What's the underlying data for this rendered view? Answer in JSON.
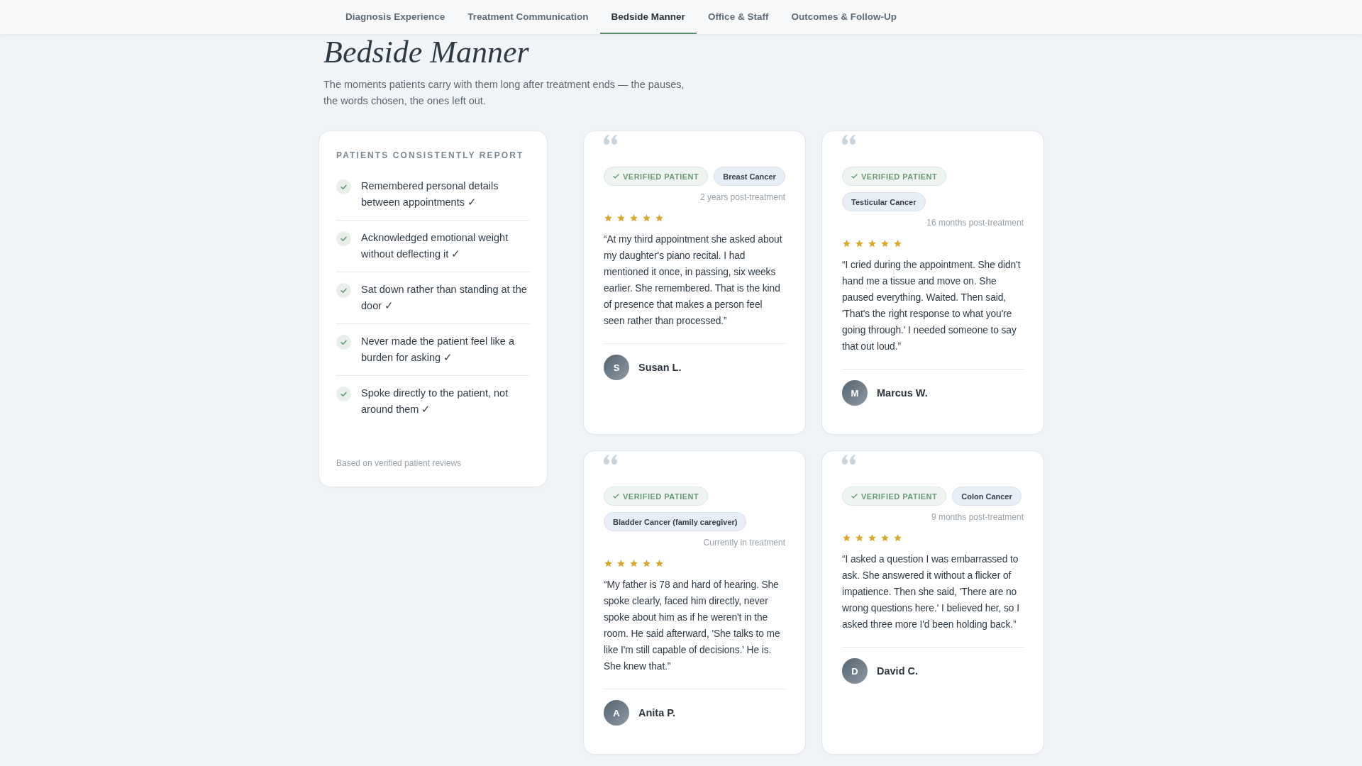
{
  "nav": {
    "tabs": [
      {
        "label": "Diagnosis Experience",
        "selected": false
      },
      {
        "label": "Treatment Communication",
        "selected": false
      },
      {
        "label": "Bedside Manner",
        "selected": true
      },
      {
        "label": "Office & Staff",
        "selected": false
      },
      {
        "label": "Outcomes & Follow-Up",
        "selected": false
      }
    ]
  },
  "header": {
    "title": "Bedside Manner",
    "description": "The moments patients carry with them long after treatment ends — the pauses, the words chosen, the ones left out."
  },
  "summary": {
    "title": "PATIENTS CONSISTENTLY REPORT",
    "items": [
      {
        "text": "Remembered personal details between appointments ✓"
      },
      {
        "text": "Acknowledged emotional weight without deflecting it ✓"
      },
      {
        "text": "Sat down rather than standing at the door ✓"
      },
      {
        "text": "Never made the patient feel like a burden for asking ✓"
      },
      {
        "text": "Spoke directly to the patient, not around them ✓"
      }
    ],
    "footnote": "Based on verified patient reviews"
  },
  "reviews": [
    {
      "verified": true,
      "verified_label": "VERIFIED PATIENT",
      "condition": "Breast Cancer",
      "timing": "2 years post-treatment",
      "stars": 5,
      "quote": "“At my third appointment she asked about my daughter's piano recital. I had mentioned it once, in passing, six weeks earlier. She remembered. That is the kind of presence that makes a person feel seen rather than processed.”",
      "initial": "S",
      "name": "Susan L."
    },
    {
      "verified": true,
      "verified_label": "VERIFIED PATIENT",
      "condition": "Testicular Cancer",
      "timing": "16 months post-treatment",
      "stars": 5,
      "quote": "“I cried during the appointment. She didn't hand me a tissue and move on. She paused everything. Waited. Then said, 'That's the right response to what you're going through.' I needed someone to say that out loud.”",
      "initial": "M",
      "name": "Marcus W."
    },
    {
      "verified": true,
      "verified_label": "VERIFIED PATIENT",
      "condition": "Bladder Cancer (family caregiver)",
      "timing": "Currently in treatment",
      "stars": 5,
      "quote": "“My father is 78 and hard of hearing. She spoke clearly, faced him directly, never spoke about him as if he weren't in the room. He said afterward, 'She talks to me like I'm still capable of decisions.' He is. She knew that.”",
      "initial": "A",
      "name": "Anita P."
    },
    {
      "verified": true,
      "verified_label": "VERIFIED PATIENT",
      "condition": "Colon Cancer",
      "timing": "9 months post-treatment",
      "stars": 5,
      "quote": "“I asked a question I was embarrassed to ask. She answered it without a flicker of impatience. Then she said, 'There are no wrong questions here.' I believed her, so I asked three more I'd been holding back.”",
      "initial": "D",
      "name": "David C."
    }
  ]
}
